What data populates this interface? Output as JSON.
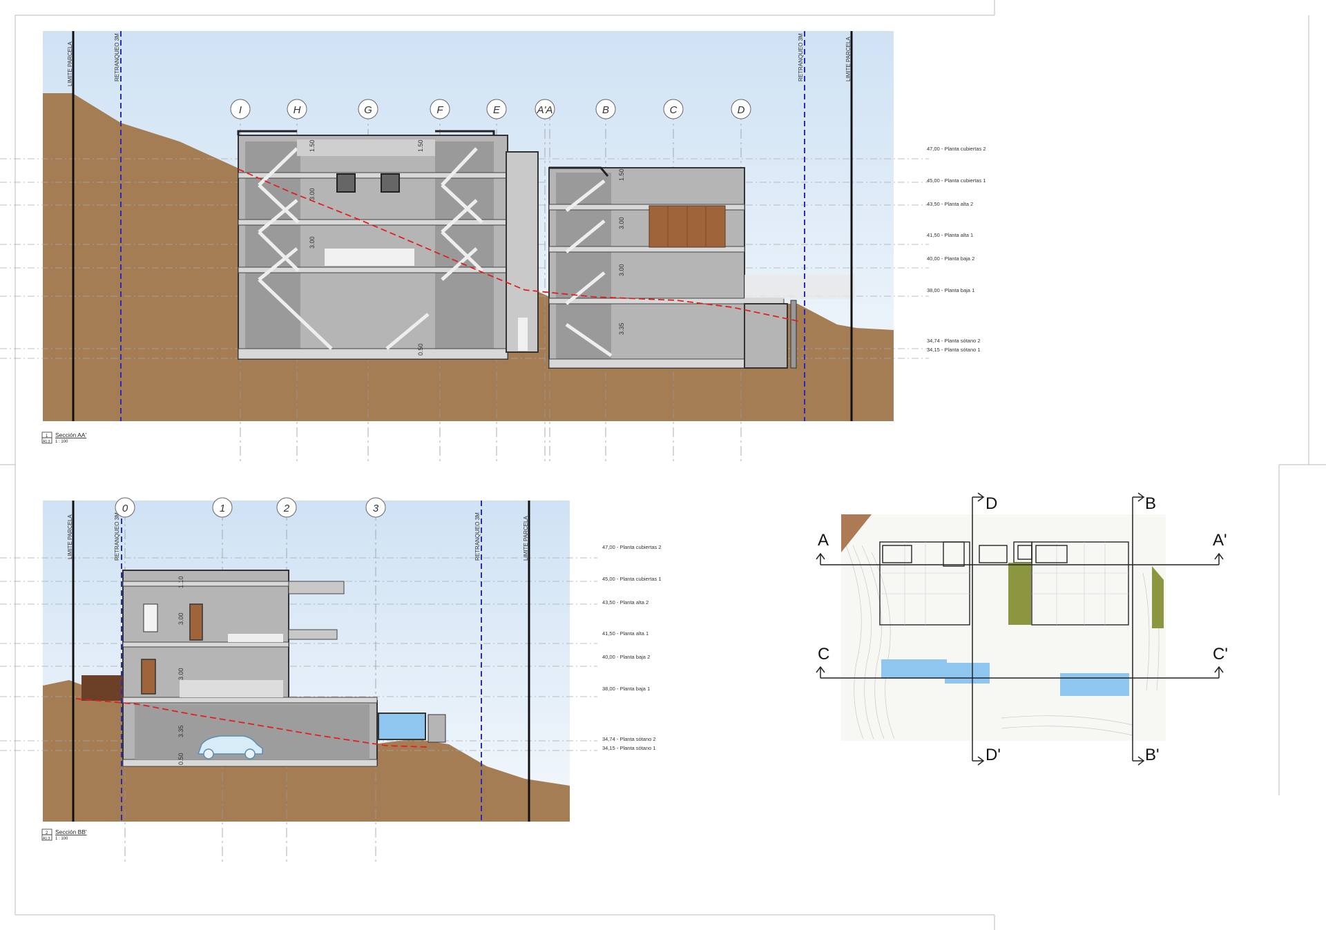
{
  "section_aa": {
    "grid_labels": [
      "I",
      "H",
      "G",
      "F",
      "E",
      "A'A",
      "B",
      "C",
      "D"
    ],
    "levels": [
      {
        "value": "47,00",
        "name": "Planta cubiertas 2"
      },
      {
        "value": "45,00",
        "name": "Planta cubiertas 1"
      },
      {
        "value": "43,50",
        "name": "Planta alta 2"
      },
      {
        "value": "41,50",
        "name": "Planta alta 1"
      },
      {
        "value": "40,00",
        "name": "Planta baja 2"
      },
      {
        "value": "38,00",
        "name": "Planta baja 1"
      },
      {
        "value": "34,74",
        "name": "Planta sótano 2"
      },
      {
        "value": "34,15",
        "name": "Planta sótano 1"
      }
    ],
    "boundary_left": "LIMITE PARCELA",
    "setback_left": "RETRANQUEO 3M",
    "setback_right": "RETRANQUEO 3M",
    "boundary_right": "LIMITE PARCELA",
    "dims": [
      "1.50",
      "3.00",
      "3.00",
      "1.50",
      "1.50",
      "3.00",
      "3.00",
      "3.35",
      "0.50"
    ],
    "title_num": "1",
    "title": "Sección AA'",
    "scale_label": "A1:3",
    "scale": "1 : 100"
  },
  "section_bb": {
    "grid_labels": [
      "0",
      "1",
      "2",
      "3"
    ],
    "levels": [
      {
        "value": "47,00",
        "name": "Planta cubiertas 2"
      },
      {
        "value": "45,00",
        "name": "Planta cubiertas 1"
      },
      {
        "value": "43,50",
        "name": "Planta alta 2"
      },
      {
        "value": "41,50",
        "name": "Planta alta 1"
      },
      {
        "value": "40,00",
        "name": "Planta baja 2"
      },
      {
        "value": "38,00",
        "name": "Planta baja 1"
      },
      {
        "value": "34,74",
        "name": "Planta sótano 2"
      },
      {
        "value": "34,15",
        "name": "Planta sótano 1"
      }
    ],
    "boundary_left": "LIMITE PARCELA",
    "setback_left": "RETRANQUEO 3M",
    "setback_right": "RETRANQUEO 3M",
    "boundary_right": "LIMITE PARCELA",
    "dims": [
      "1.10",
      "3.00",
      "3.00",
      "3.35",
      "0.50"
    ],
    "title_num": "2",
    "title": "Sección BB'",
    "scale_label": "A1:3",
    "scale": "1 : 100"
  },
  "key_plan": {
    "A": "A",
    "A2": "A'",
    "B": "B",
    "B2": "B'",
    "C": "C",
    "C2": "C'",
    "D": "D",
    "D2": "D'"
  },
  "colors": {
    "ground": "#a47d55",
    "sky": "#dbe9f6",
    "building": "#b3b3b3",
    "setback_line": "#2b2bb8",
    "profile_line": "#e02020",
    "pool": "#8ec6ef",
    "green": "#8c9640"
  }
}
